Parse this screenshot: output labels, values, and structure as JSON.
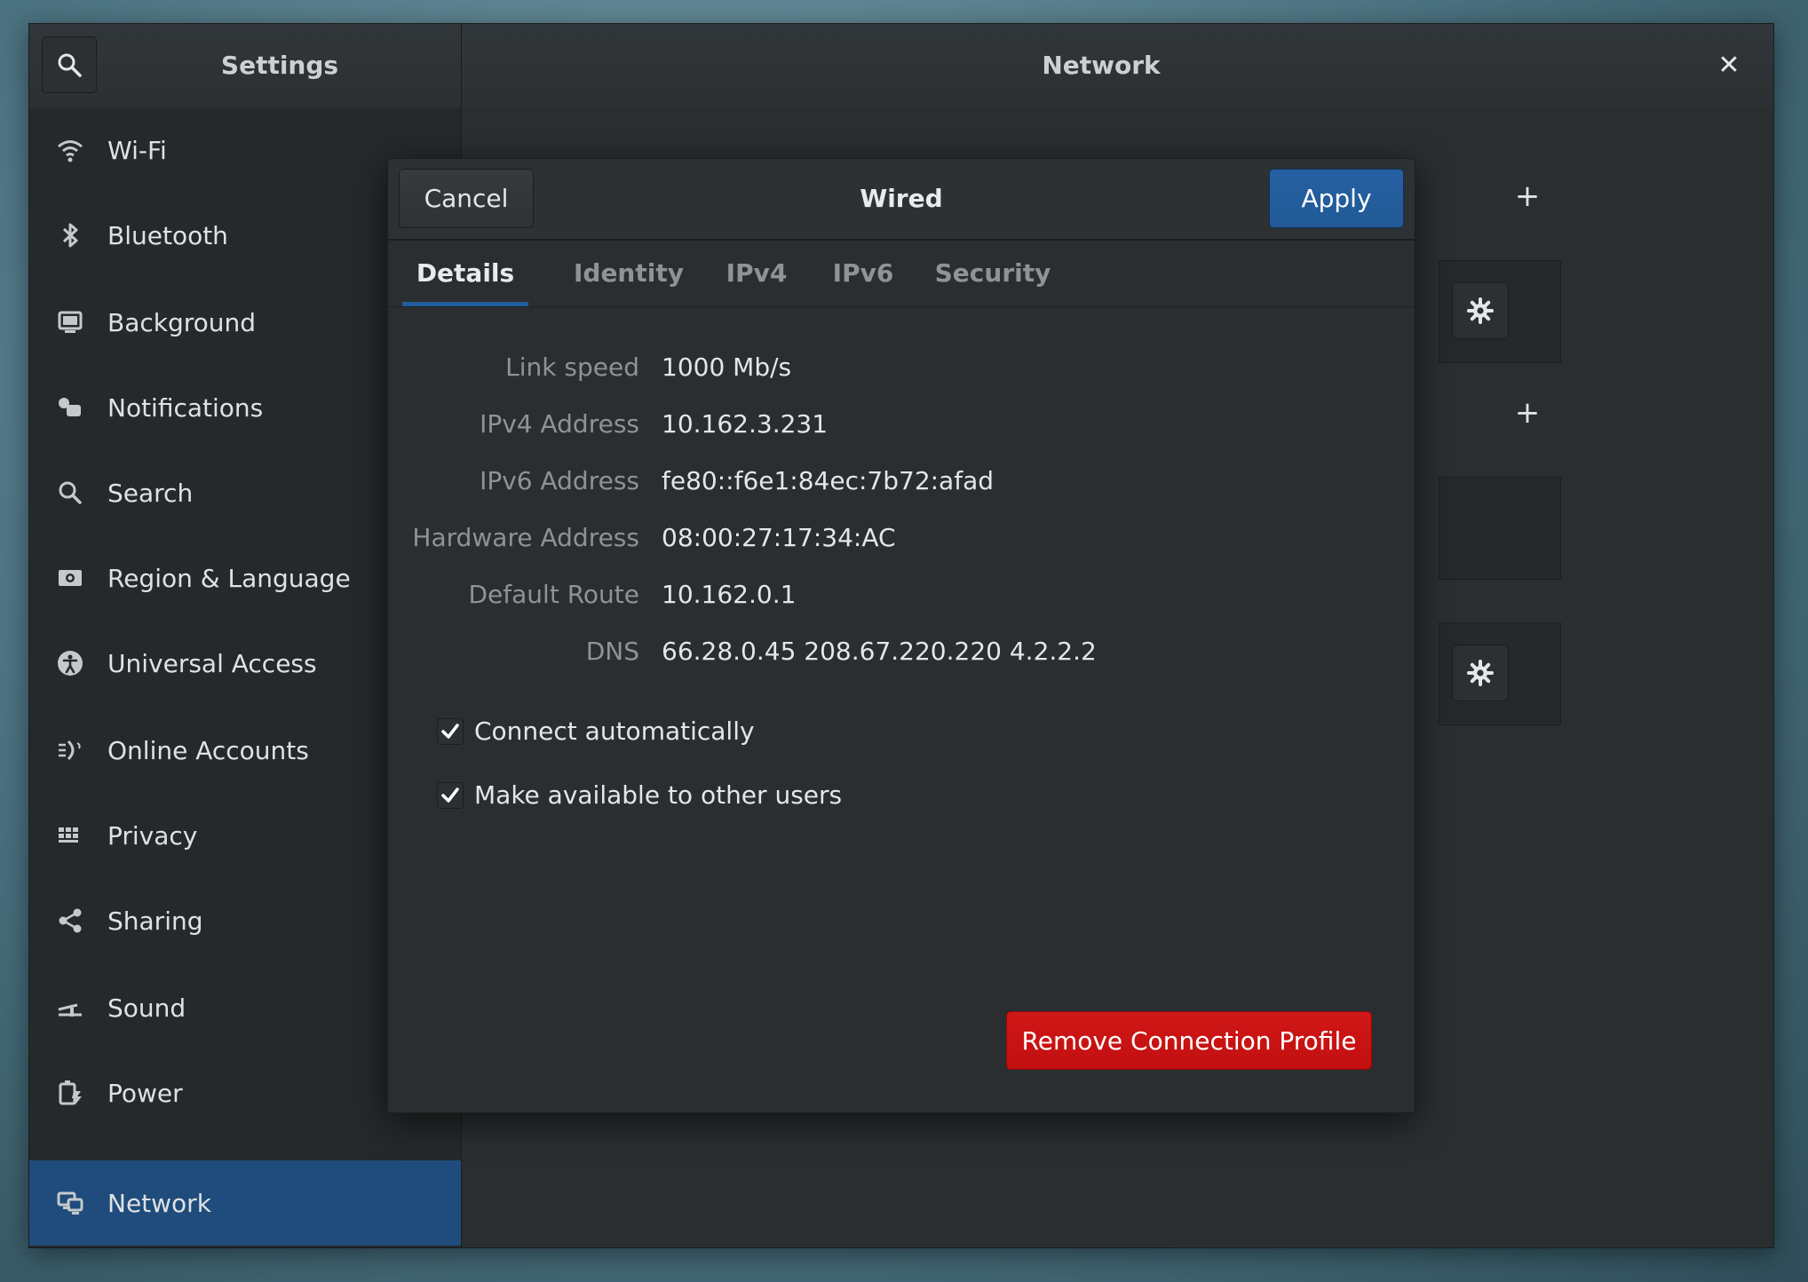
{
  "window": {
    "settings_title": "Settings",
    "panel_title": "Network",
    "close_symbol": "✕"
  },
  "sidebar": {
    "items": [
      {
        "label": "Wi-Fi",
        "icon": "wifi-icon"
      },
      {
        "label": "Bluetooth",
        "icon": "bluetooth-icon"
      },
      {
        "label": "Background",
        "icon": "background-icon"
      },
      {
        "label": "Notifications",
        "icon": "notifications-icon"
      },
      {
        "label": "Search",
        "icon": "search-icon"
      },
      {
        "label": "Region & Language",
        "icon": "region-icon"
      },
      {
        "label": "Universal Access",
        "icon": "universal-access-icon"
      },
      {
        "label": "Online Accounts",
        "icon": "online-accounts-icon"
      },
      {
        "label": "Privacy",
        "icon": "privacy-icon"
      },
      {
        "label": "Sharing",
        "icon": "sharing-icon"
      },
      {
        "label": "Sound",
        "icon": "sound-icon"
      },
      {
        "label": "Power",
        "icon": "power-icon"
      },
      {
        "label": "Network",
        "icon": "network-icon",
        "active": true
      }
    ]
  },
  "main": {
    "plus_symbol": "+"
  },
  "dialog": {
    "title": "Wired",
    "cancel_label": "Cancel",
    "apply_label": "Apply",
    "tabs": [
      "Details",
      "Identity",
      "IPv4",
      "IPv6",
      "Security"
    ],
    "active_tab": "Details",
    "details": [
      {
        "label": "Link speed",
        "value": "1000 Mb/s"
      },
      {
        "label": "IPv4 Address",
        "value": "10.162.3.231"
      },
      {
        "label": "IPv6 Address",
        "value": "fe80::f6e1:84ec:7b72:afad"
      },
      {
        "label": "Hardware Address",
        "value": "08:00:27:17:34:AC"
      },
      {
        "label": "Default Route",
        "value": "10.162.0.1"
      },
      {
        "label": "DNS",
        "value": "66.28.0.45 208.67.220.220 4.2.2.2"
      }
    ],
    "checkboxes": [
      {
        "label": "Connect automatically",
        "checked": true
      },
      {
        "label": "Make available to other users",
        "checked": true
      }
    ],
    "remove_label": "Remove Connection Profile"
  },
  "colors": {
    "accent": "#1f4c7c",
    "apply": "#215d9c",
    "destructive": "#c20f0f"
  }
}
